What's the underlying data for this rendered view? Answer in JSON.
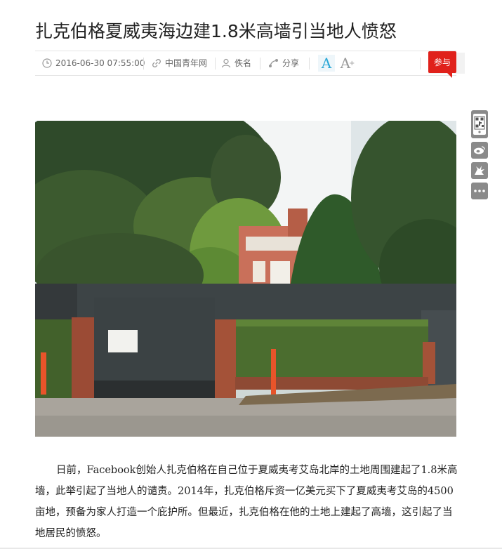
{
  "article": {
    "title": "扎克伯格夏威夷海边建1.8米高墙引当地人愤怒",
    "paragraph": "日前，Facebook创始人扎克伯格在自己位于夏威夷考艾岛北岸的土地周围建起了1.8米高墙，此举引起了当地人的谴责。2014年，扎克伯格斥资一亿美元买下了夏威夷考艾岛的4500亩地，预备为家人打造一个庇护所。但最近，扎克伯格在他的土地上建起了高墙，这引起了当地居民的愤怒。"
  },
  "meta": {
    "datetime": "2016-06-30 07:55:00",
    "source": "中国青年网",
    "author": "佚名",
    "share_label": "分享",
    "font_normal": "A",
    "font_large": "A",
    "font_plus": "+",
    "join_label": "参与"
  },
  "icons": {
    "clock": "clock-icon",
    "link": "link-icon",
    "person": "person-icon",
    "share": "share-icon",
    "qr": "qr-code-icon",
    "weibo": "weibo-icon",
    "wechat": "wechat-icon",
    "more": "more-icon"
  },
  "colors": {
    "accent": "#2aa7d6",
    "join_button": "#e0211b",
    "side_tool": "#8a8a8a"
  }
}
